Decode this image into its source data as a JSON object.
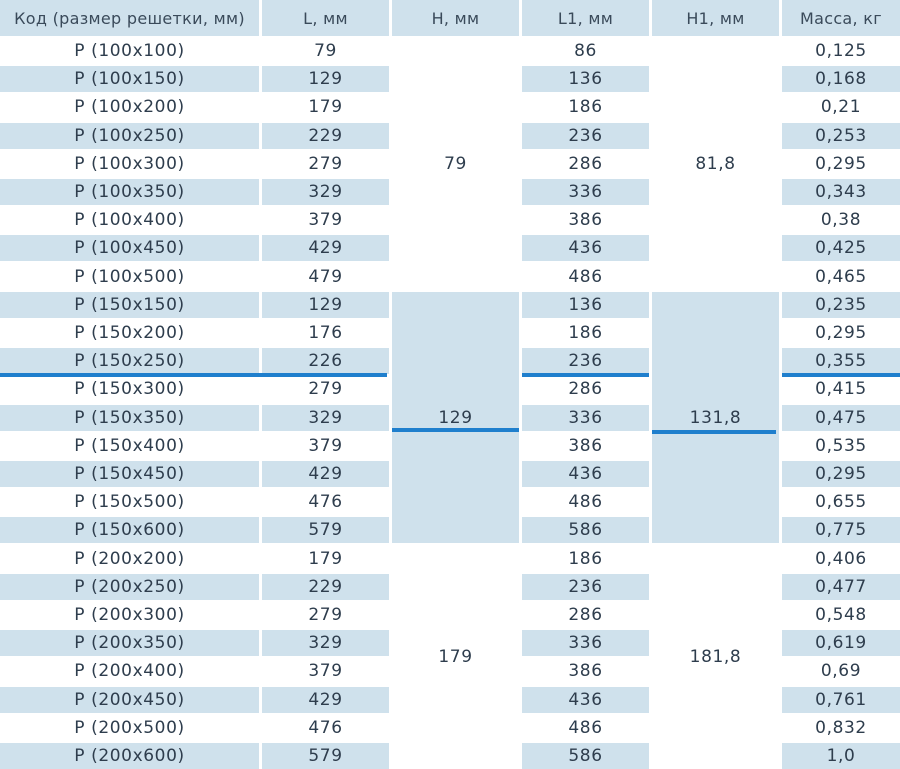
{
  "headers": [
    "Код (размер решетки, мм)",
    "L, мм",
    "H, мм",
    "L1, мм",
    "H1, мм",
    "Масса, кг"
  ],
  "rows": [
    {
      "code": "P (100x100)",
      "l": "79",
      "l1": "86",
      "mass": "0,125"
    },
    {
      "code": "P (100x150)",
      "l": "129",
      "l1": "136",
      "mass": "0,168"
    },
    {
      "code": "P (100x200)",
      "l": "179",
      "l1": "186",
      "mass": "0,21"
    },
    {
      "code": "P (100x250)",
      "l": "229",
      "l1": "236",
      "mass": "0,253"
    },
    {
      "code": "P (100x300)",
      "l": "279",
      "l1": "286",
      "mass": "0,295"
    },
    {
      "code": "P (100x350)",
      "l": "329",
      "l1": "336",
      "mass": "0,343"
    },
    {
      "code": "P (100x400)",
      "l": "379",
      "l1": "386",
      "mass": "0,38"
    },
    {
      "code": "P (100x450)",
      "l": "429",
      "l1": "436",
      "mass": "0,425"
    },
    {
      "code": "P (100x500)",
      "l": "479",
      "l1": "486",
      "mass": "0,465"
    },
    {
      "code": "P (150x150)",
      "l": "129",
      "l1": "136",
      "mass": "0,235"
    },
    {
      "code": "P (150x200)",
      "l": "176",
      "l1": "186",
      "mass": "0,295"
    },
    {
      "code": "P (150x250)",
      "l": "226",
      "l1": "236",
      "mass": "0,355"
    },
    {
      "code": "P (150x300)",
      "l": "279",
      "l1": "286",
      "mass": "0,415"
    },
    {
      "code": "P (150x350)",
      "l": "329",
      "l1": "336",
      "mass": "0,475"
    },
    {
      "code": "P (150x400)",
      "l": "379",
      "l1": "386",
      "mass": "0,535"
    },
    {
      "code": "P (150x450)",
      "l": "429",
      "l1": "436",
      "mass": "0,295"
    },
    {
      "code": "P (150x500)",
      "l": "476",
      "l1": "486",
      "mass": "0,655"
    },
    {
      "code": "P (150x600)",
      "l": "579",
      "l1": "586",
      "mass": "0,775"
    },
    {
      "code": "P (200x200)",
      "l": "179",
      "l1": "186",
      "mass": "0,406"
    },
    {
      "code": "P (200x250)",
      "l": "229",
      "l1": "236",
      "mass": "0,477"
    },
    {
      "code": "P (200x300)",
      "l": "279",
      "l1": "286",
      "mass": "0,548"
    },
    {
      "code": "P (200x350)",
      "l": "329",
      "l1": "336",
      "mass": "0,619"
    },
    {
      "code": "P (200x400)",
      "l": "379",
      "l1": "386",
      "mass": "0,69"
    },
    {
      "code": "P (200x450)",
      "l": "429",
      "l1": "436",
      "mass": "0,761"
    },
    {
      "code": "P (200x500)",
      "l": "476",
      "l1": "486",
      "mass": "0,832"
    },
    {
      "code": "P (200x600)",
      "l": "579",
      "l1": "586",
      "mass": "1,0"
    }
  ],
  "groups": [
    {
      "rows": 9,
      "h": "79",
      "h1": "81,8"
    },
    {
      "rows": 9,
      "h": "129",
      "h1": "131,8"
    },
    {
      "rows": 8,
      "h": "179",
      "h1": "181,8"
    }
  ]
}
